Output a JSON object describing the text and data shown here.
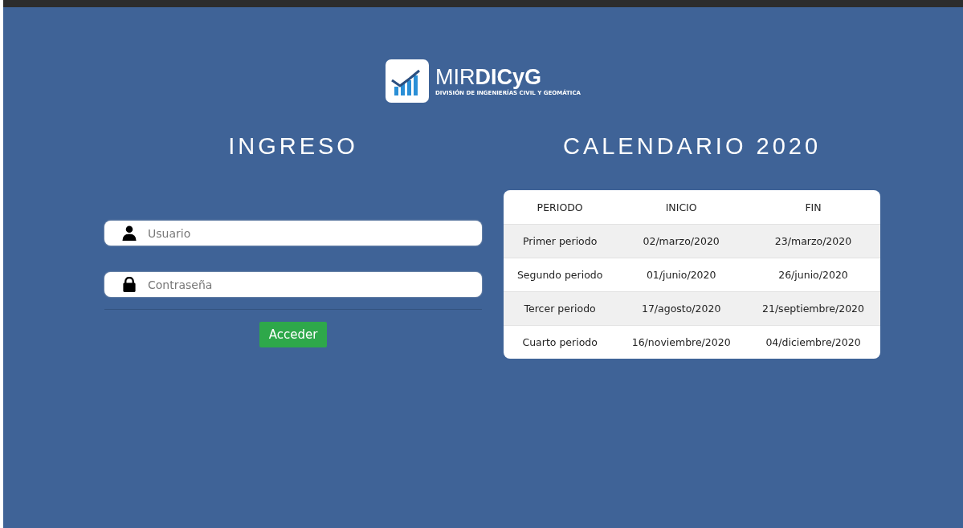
{
  "logo": {
    "name": "MIR**DICyG**",
    "subtitle": "DIVISIÓN DE INGENIERÍAS CIVIL Y GEOMÁTICA"
  },
  "login": {
    "title": "INGRESO",
    "fields": [
      {
        "kind": "user",
        "placeholder": "Usuario"
      },
      {
        "kind": "password",
        "placeholder": "Contraseña"
      }
    ],
    "button": "Acceder"
  },
  "calendar": {
    "title": "CALENDARIO 2020",
    "columns": [
      "PERIODO",
      "INICIO",
      "FIN"
    ],
    "rows": [
      [
        "Primer periodo",
        "02/marzo/2020",
        "23/marzo/2020"
      ],
      [
        "Segundo periodo",
        "01/junio/2020",
        "26/junio/2020"
      ],
      [
        "Tercer periodo",
        "17/agosto/2020",
        "21/septiembre/2020"
      ],
      [
        "Cuarto periodo",
        "16/noviembre/2020",
        "04/diciembre/2020"
      ]
    ]
  }
}
